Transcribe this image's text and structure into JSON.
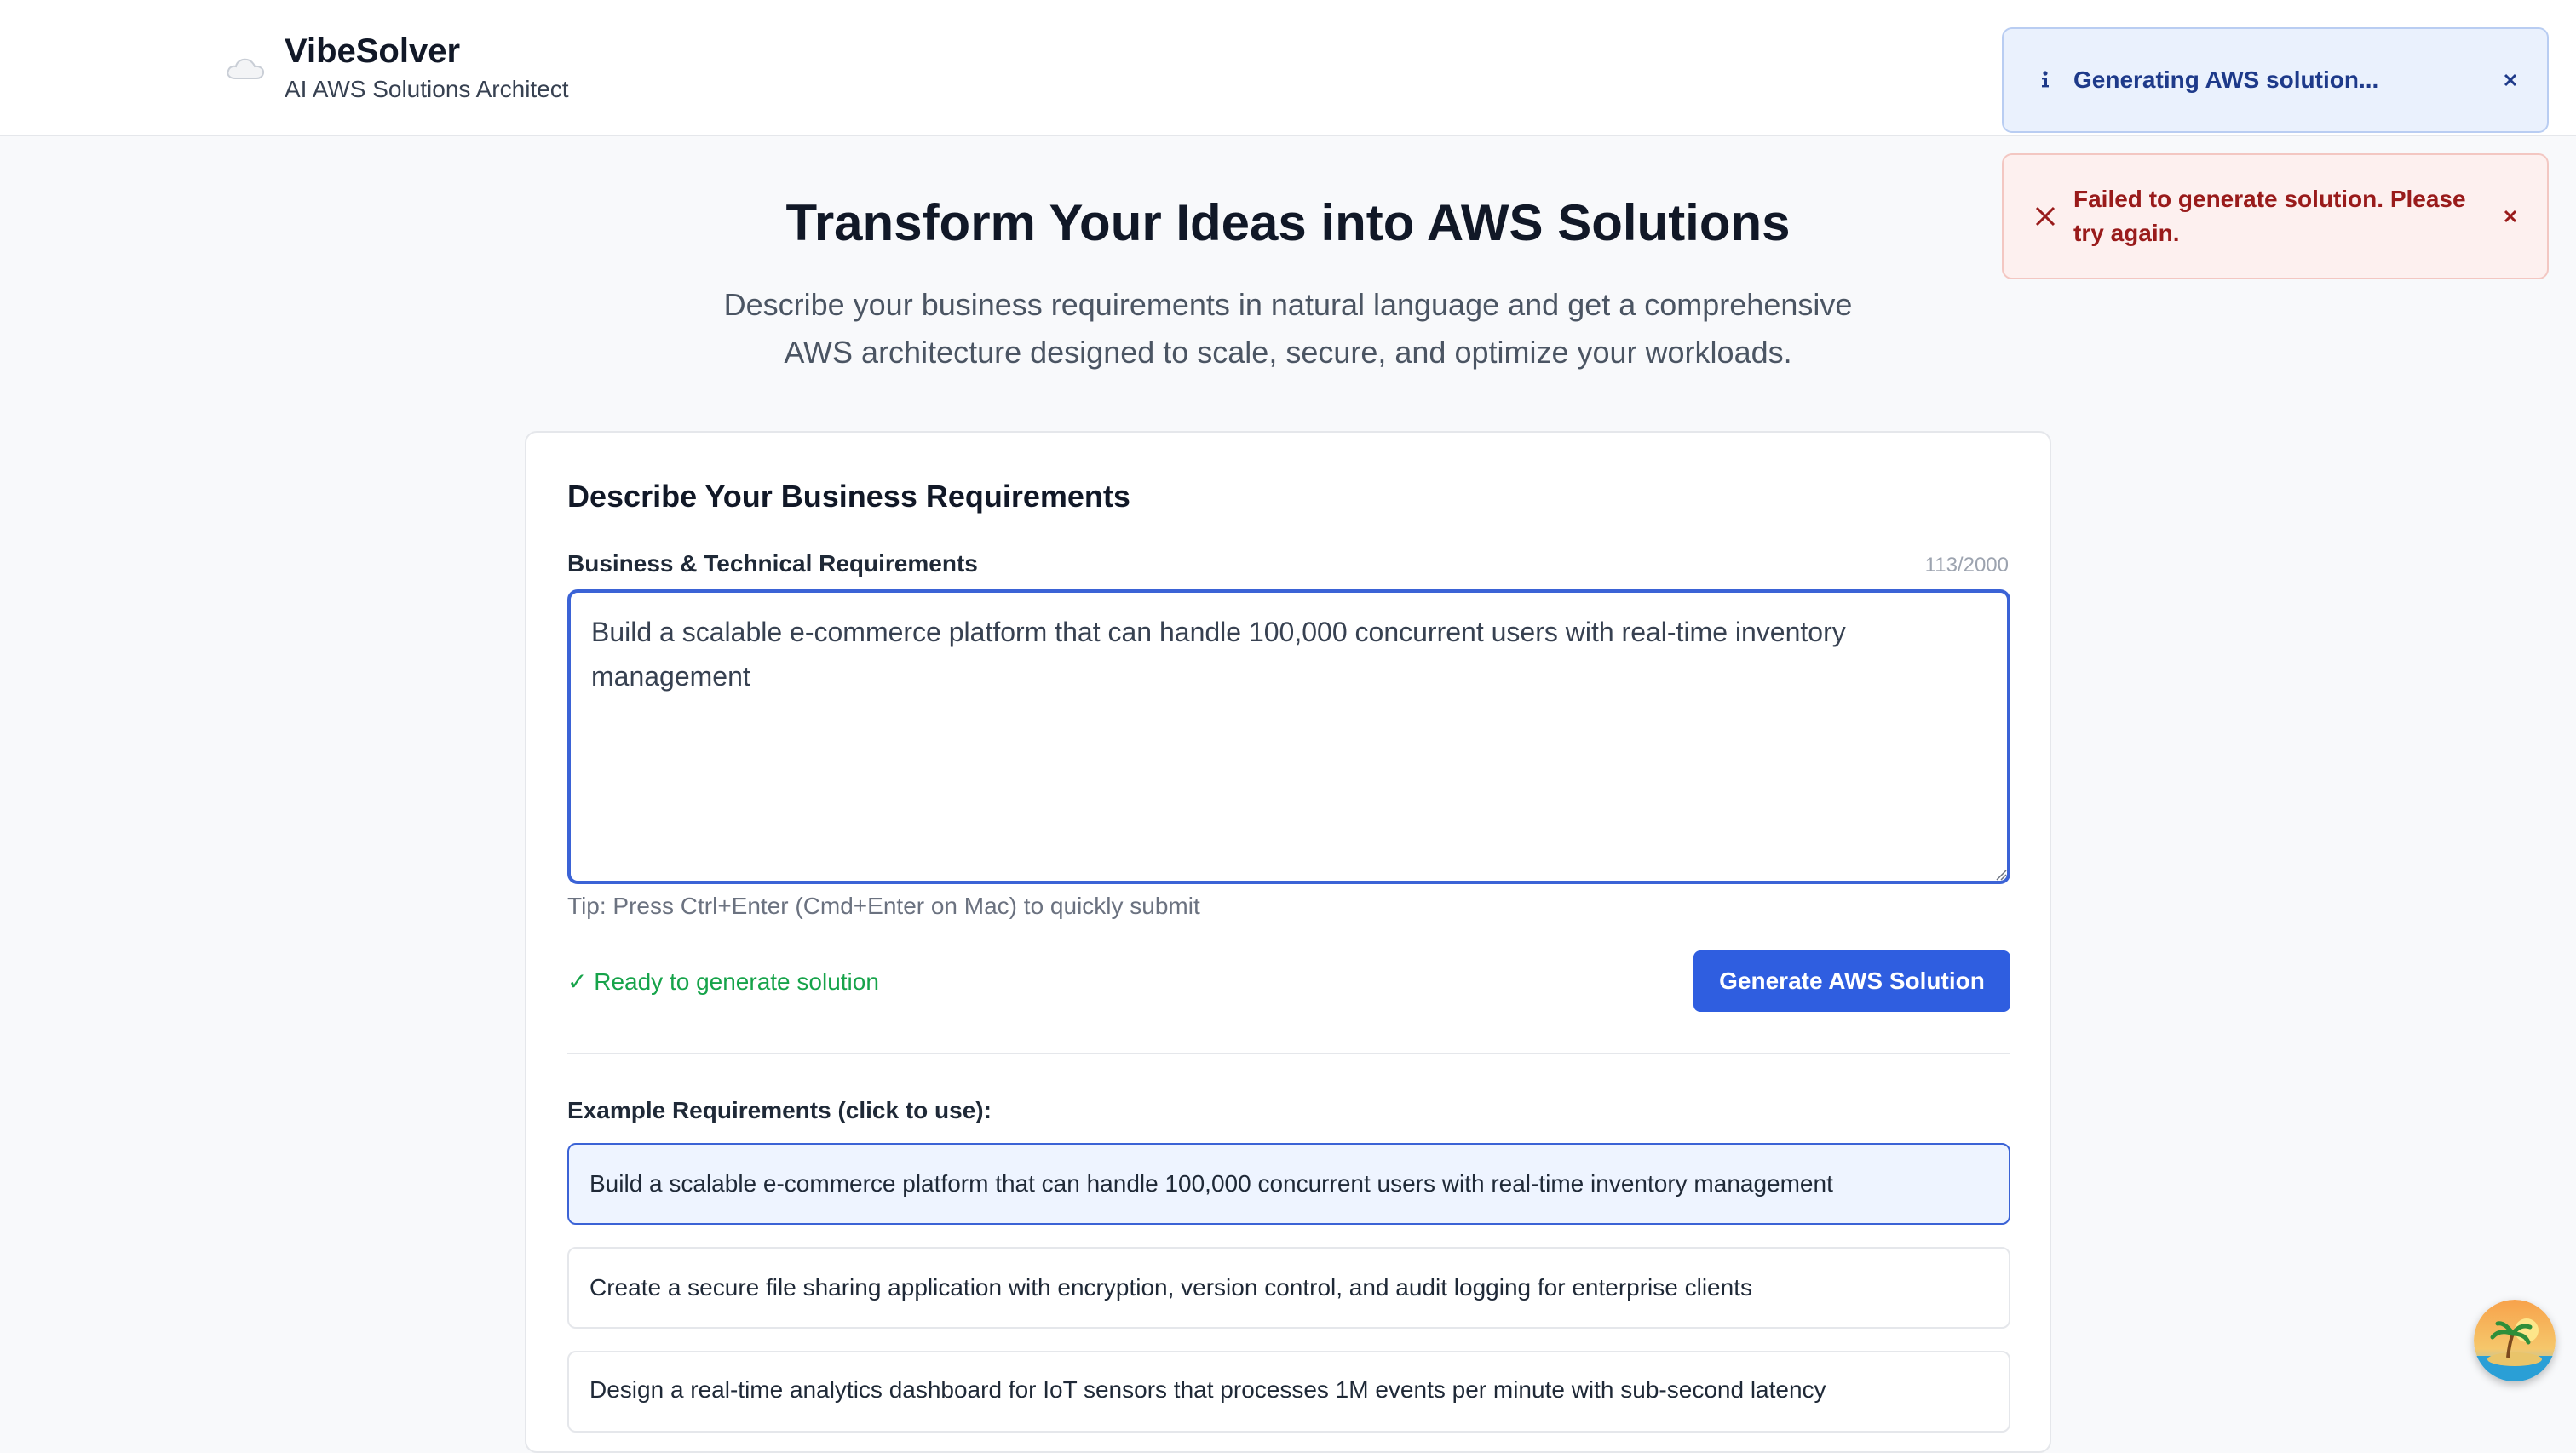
{
  "header": {
    "app_name": "VibeSolver",
    "tagline": "AI AWS Solutions Architect",
    "logo_icon": "cloud-icon"
  },
  "hero": {
    "title": "Transform Your Ideas into AWS Solutions",
    "subtitle": "Describe your business requirements in natural language and get a comprehensive AWS architecture designed to scale, secure, and optimize your workloads."
  },
  "form": {
    "card_title": "Describe Your Business Requirements",
    "field_label": "Business & Technical Requirements",
    "char_count": "113/2000",
    "textarea_value": "Build a scalable e-commerce platform that can handle 100,000 concurrent users with real-time inventory management",
    "tip": "Tip: Press Ctrl+Enter (Cmd+Enter on Mac) to quickly submit",
    "status": "✓ Ready to generate solution",
    "submit_label": "Generate AWS Solution"
  },
  "examples": {
    "label": "Example Requirements (click to use):",
    "items": [
      "Build a scalable e-commerce platform that can handle 100,000 concurrent users with real-time inventory management",
      "Create a secure file sharing application with encryption, version control, and audit logging for enterprise clients",
      "Design a real-time analytics dashboard for IoT sensors that processes 1M events per minute with sub-second latency"
    ]
  },
  "toasts": {
    "info": "Generating AWS solution...",
    "error": "Failed to generate solution. Please try again."
  },
  "colors": {
    "primary": "#2f5ee0",
    "success": "#16a34a",
    "error": "#991b1b",
    "info": "#1e3a8a"
  }
}
